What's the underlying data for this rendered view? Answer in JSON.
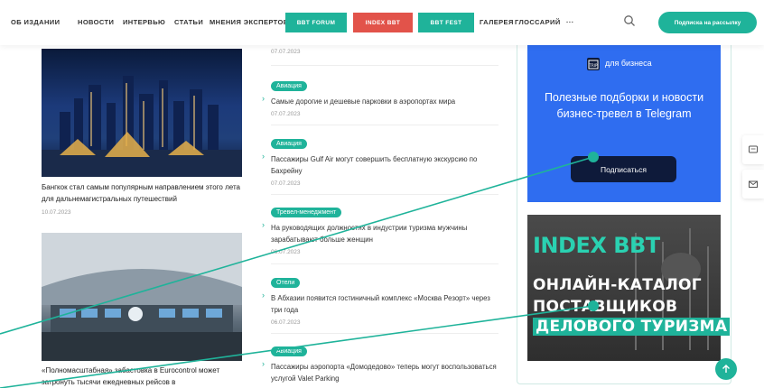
{
  "nav": {
    "links": [
      "ОБ ИЗДАНИИ",
      "НОВОСТИ",
      "ИНТЕРВЬЮ",
      "СТАТЬИ",
      "МНЕНИЯ ЭКСПЕРТОВ"
    ],
    "forum_label": "BBT FORUM",
    "index_label": "INDEX BBT",
    "fest_label": "BBT FEST",
    "gallery_label": "ГАЛЕРЕЯ",
    "glossary_label": "ГЛОССАРИЙ",
    "more_label": "···",
    "subscribe_label": "Подписка на рассылку",
    "forum_color": "#1fb39a",
    "index_color": "#e2534a",
    "fest_color": "#1fb39a"
  },
  "left_news": [
    {
      "title": "Бангкок стал самым популярным направлением этого лета для дальнемагистральных путешествий",
      "date": "10.07.2023"
    },
    {
      "title": "«Полномасштабная» забастовка в Eurocontrol может затронуть тысячи ежедневных рейсов в",
      "date": ""
    }
  ],
  "mid_news": [
    {
      "tag": "",
      "title": "",
      "date": "07.07.2023"
    },
    {
      "tag": "Авиация",
      "title": "Самые дорогие и дешевые парковки в аэропортах мира",
      "date": "07.07.2023"
    },
    {
      "tag": "Авиация",
      "title": "Пассажиры Gulf Air могут совершить бесплатную экскурсию по Бахрейну",
      "date": "07.07.2023"
    },
    {
      "tag": "Тревел-менеджмент",
      "title": "На руководящих должностях в индустрии туризма мужчины зарабатывают больше женщин",
      "date": "06.07.2023"
    },
    {
      "tag": "Отели",
      "title": "В Абхазии появится гостиничный комплекс «Москва Резорт» через три года",
      "date": "06.07.2023"
    },
    {
      "tag": "Авиация",
      "title": "Пассажиры аэропорта «Домодедово» теперь могут воспользоваться услугой Valet Parking",
      "date": ""
    }
  ],
  "telegram_banner": {
    "logo_text": "TRIP",
    "brand": "для бизнеса",
    "text": "Полезные подборки и новости бизнес-тревел в Telegram",
    "button": "Подписаться",
    "bg_color": "#2f6df0"
  },
  "bbt_banner": {
    "logo": "INDEX BBT",
    "line1": "ОНЛАЙН-КАТАЛОГ",
    "line2": "ПОСТАВЩИКОВ",
    "line3": "ДЕЛОВОГО ТУРИЗМА"
  },
  "side_tabs": [
    "chat-icon",
    "mail-icon"
  ],
  "scroll_top_icon": "arrow-up-icon",
  "accent": "#1fb39a"
}
